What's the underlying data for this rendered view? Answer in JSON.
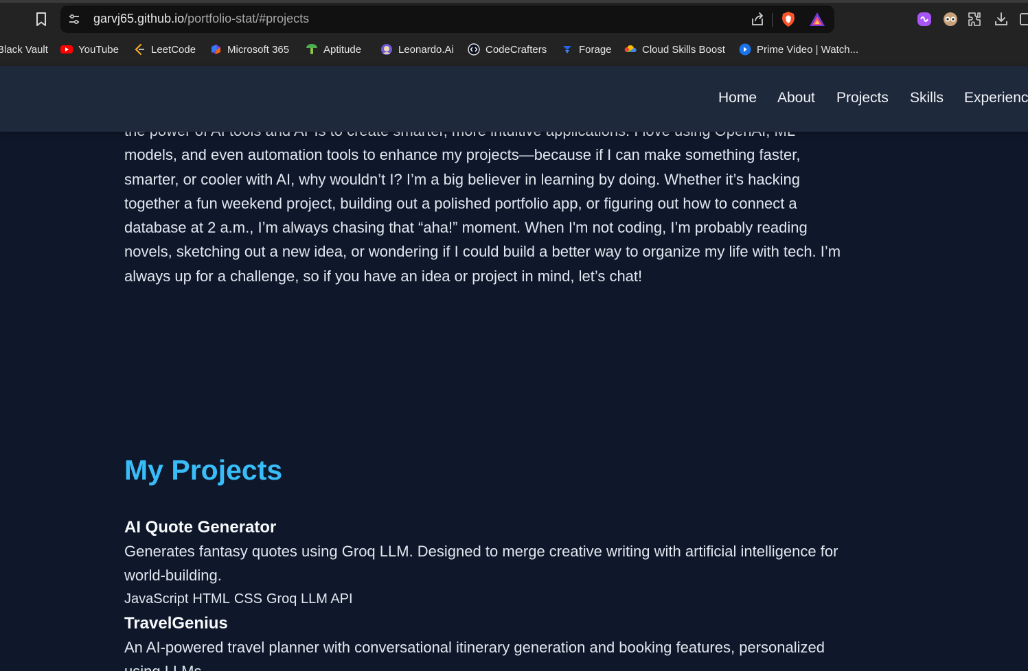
{
  "browser": {
    "url_host": "garvj65.github.io",
    "url_path": "/portfolio-stat/#projects",
    "bookmarks": [
      {
        "label": "Black Vault",
        "icon": "none"
      },
      {
        "label": "YouTube",
        "icon": "youtube-icon"
      },
      {
        "label": "LeetCode",
        "icon": "leetcode-icon"
      },
      {
        "label": "Microsoft 365",
        "icon": "microsoft365-icon"
      },
      {
        "label": "Aptitude",
        "icon": "aptitude-icon"
      },
      {
        "label": "Leonardo.Ai",
        "icon": "leonardo-icon"
      },
      {
        "label": "CodeCrafters",
        "icon": "codecrafters-icon"
      },
      {
        "label": "Forage",
        "icon": "forage-icon"
      },
      {
        "label": "Cloud Skills Boost",
        "icon": "google-cloud-icon"
      },
      {
        "label": "Prime Video | Watch...",
        "icon": "prime-video-icon"
      }
    ]
  },
  "nav": {
    "items": [
      "Home",
      "About",
      "Projects",
      "Skills",
      "Experienc"
    ]
  },
  "about": {
    "text": "the power of AI tools and APIs to create smarter, more intuitive applications. I love using OpenAI, ML models, and even automation tools to enhance my projects—because if I can make something faster, smarter, or cooler with AI, why wouldn’t I? I’m a big believer in learning by doing. Whether it’s hacking together a fun weekend project, building out a polished portfolio app, or figuring out how to connect a database at 2 a.m., I’m always chasing that “aha!” moment. When I'm not coding, I’m probably reading novels, sketching out a new idea, or wondering if I could build a better way to organize my life with tech. I’m always up for a challenge, so if you have an idea or project in mind, let’s chat!"
  },
  "projects": {
    "title": "My Projects",
    "items": [
      {
        "name": "AI Quote Generator",
        "description": "Generates fantasy quotes using Groq LLM. Designed to merge creative writing with artificial intelligence for world-building.",
        "tags": [
          "JavaScript",
          "HTML",
          "CSS",
          "Groq LLM API"
        ]
      },
      {
        "name": "TravelGenius",
        "description": "An AI-powered travel planner with conversational itinerary generation and booking features, personalized using LLMs."
      }
    ]
  },
  "colors": {
    "page_bg": "#0f172a",
    "nav_bg": "#1e293b",
    "accent": "#38bdf8"
  }
}
